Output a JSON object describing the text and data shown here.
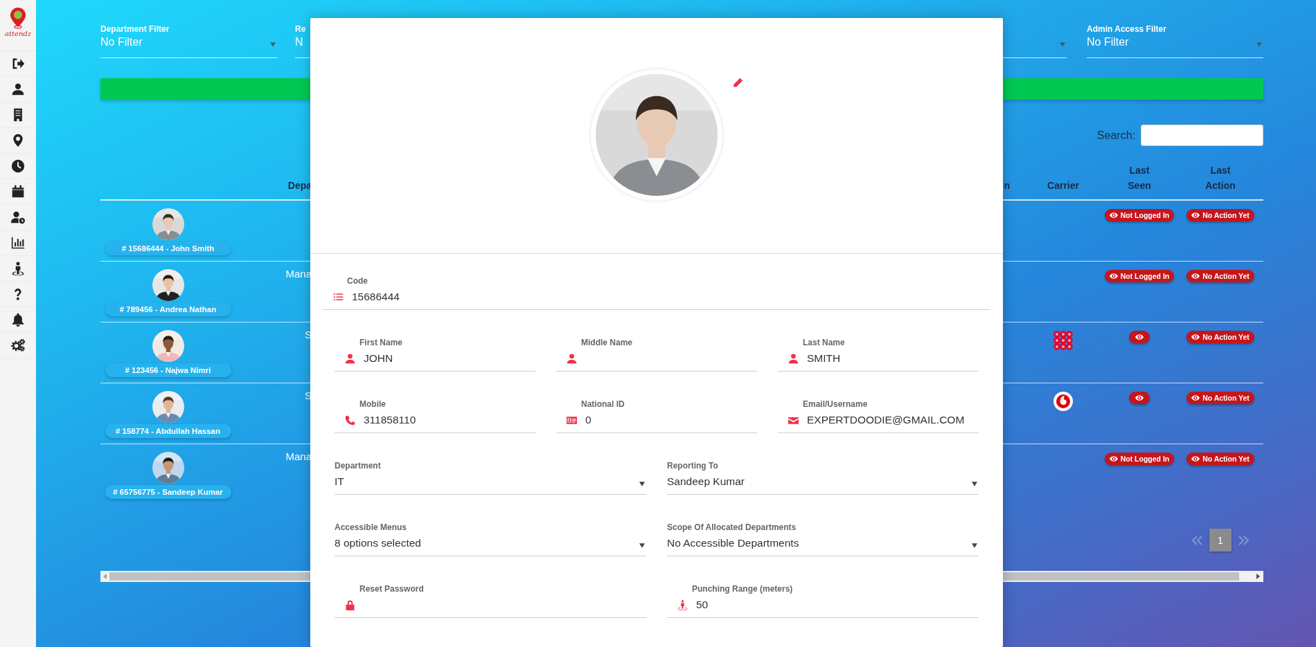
{
  "logo": "attendz",
  "filters_left": [
    {
      "kind": "select",
      "label": "Department Filter",
      "value": "No Filter"
    },
    {
      "kind": "partial",
      "label": "Re",
      "value": "N"
    }
  ],
  "filters_right": [
    {
      "kind": "select"
    },
    {
      "kind": "select",
      "label": "Admin Access Filter",
      "value": "No Filter"
    }
  ],
  "search": {
    "label": "Search:"
  },
  "table": {
    "columns": [
      "",
      "Depa",
      "n",
      "Carrier",
      "Last Seen",
      "Last Action"
    ],
    "rows": [
      {
        "employee": "# 15686444 - John Smith",
        "last_seen": "Not Logged In",
        "last_action": "No Action Yet"
      },
      {
        "employee": "# 789456 - Andrea Nathan",
        "department": "Mana",
        "last_seen": "Not Logged In",
        "last_action": "No Action Yet"
      },
      {
        "employee": "# 123456 - Najwa Nimri",
        "department": "S",
        "carrier": {
          "kind": "dot-grid"
        },
        "last_action": "No Action Yet"
      },
      {
        "employee": "# 158774 - Abdullah Hassan",
        "department": "S",
        "carrier": {
          "kind": "drop"
        },
        "last_action": "No Action Yet"
      },
      {
        "employee": "# 65756775 - Sandeep Kumar",
        "department": "Mana",
        "last_seen": "Not Logged In",
        "last_action": "No Action Yet"
      }
    ]
  },
  "pagination": {
    "previous_disabled": true,
    "next_disabled": true,
    "pages": [
      {
        "label": "1",
        "selected": true
      }
    ]
  },
  "modal": {
    "code_field": {
      "kind": "code",
      "label": "Code",
      "value": "15686444"
    },
    "field_rows": [
      [
        {
          "kind": "name",
          "label": "First Name",
          "value": "JOHN"
        },
        {
          "kind": "name",
          "label": "Middle Name"
        },
        {
          "kind": "name",
          "label": "Last Name",
          "value": "SMITH"
        }
      ],
      [
        {
          "kind": "phone",
          "label": "Mobile",
          "value": "311858110"
        },
        {
          "kind": "national-id",
          "label": "National ID",
          "value": "0"
        },
        {
          "kind": "email",
          "label": "Email/Username",
          "value": "EXPERTDOODIE@GMAIL.COM"
        }
      ],
      [
        {
          "kind": "select",
          "label": "Department",
          "value": "IT"
        },
        {
          "kind": "select",
          "label": "Reporting To",
          "value": "Sandeep Kumar"
        }
      ],
      [
        {
          "kind": "select",
          "label": "Accessible Menus",
          "value": "8 options selected"
        },
        {
          "kind": "select",
          "label": "Scope Of Allocated Departments",
          "value": "No Accessible Departments"
        }
      ],
      [
        {
          "kind": "password",
          "label": "Reset Password"
        },
        {
          "kind": "range",
          "label": "Punching Range (meters)",
          "value": "50"
        }
      ]
    ]
  }
}
